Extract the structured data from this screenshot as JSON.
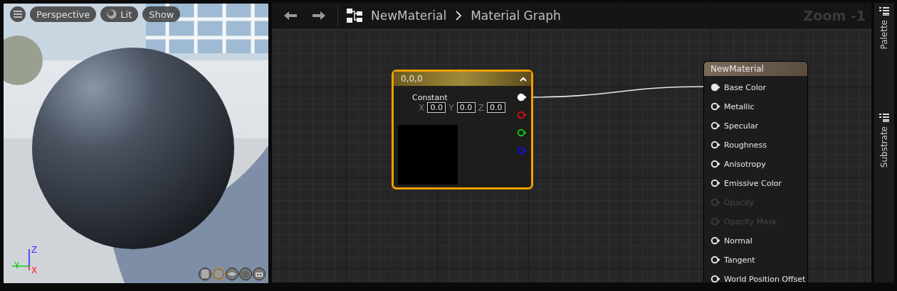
{
  "viewport": {
    "toolbar": [
      {
        "kind": "menu"
      },
      {
        "kind": "text",
        "label": "Perspective"
      },
      {
        "kind": "lit",
        "label": "Lit"
      },
      {
        "kind": "text",
        "label": "Show"
      }
    ],
    "axes": {
      "z": "Z",
      "y": "Y",
      "x": "X"
    },
    "preview_shapes": [
      {
        "kind": "cylinder",
        "selected": false
      },
      {
        "kind": "sphere",
        "selected": true
      },
      {
        "kind": "plane",
        "selected": false
      },
      {
        "kind": "cube",
        "selected": false
      },
      {
        "kind": "teapot",
        "selected": false
      }
    ]
  },
  "graph": {
    "breadcrumb": [
      "NewMaterial",
      "Material Graph"
    ],
    "zoom": "Zoom -1",
    "constant_node": {
      "title": "0,0,0",
      "subtitle": "Constant",
      "fields": [
        {
          "label": "X",
          "value": "0.0"
        },
        {
          "label": "Y",
          "value": "0.0"
        },
        {
          "label": "Z",
          "value": "0.0"
        }
      ],
      "outputs": [
        {
          "color": "#ffffff",
          "connected": true
        },
        {
          "color": "#d01010",
          "connected": false
        },
        {
          "color": "#10c010",
          "connected": false
        },
        {
          "color": "#1010e0",
          "connected": false
        }
      ]
    },
    "material_node": {
      "title": "NewMaterial",
      "inputs": [
        {
          "label": "Base Color",
          "connected": true,
          "disabled": false
        },
        {
          "label": "Metallic",
          "connected": false,
          "disabled": false
        },
        {
          "label": "Specular",
          "connected": false,
          "disabled": false
        },
        {
          "label": "Roughness",
          "connected": false,
          "disabled": false
        },
        {
          "label": "Anisotropy",
          "connected": false,
          "disabled": false
        },
        {
          "label": "Emissive Color",
          "connected": false,
          "disabled": false
        },
        {
          "label": "Opacity",
          "connected": false,
          "disabled": true
        },
        {
          "label": "Opacity Mask",
          "connected": false,
          "disabled": true
        },
        {
          "label": "Normal",
          "connected": false,
          "disabled": false
        },
        {
          "label": "Tangent",
          "connected": false,
          "disabled": false
        },
        {
          "label": "World Position Offset",
          "connected": false,
          "disabled": false
        }
      ]
    }
  },
  "side_tabs": [
    "Palette",
    "Substrate"
  ]
}
